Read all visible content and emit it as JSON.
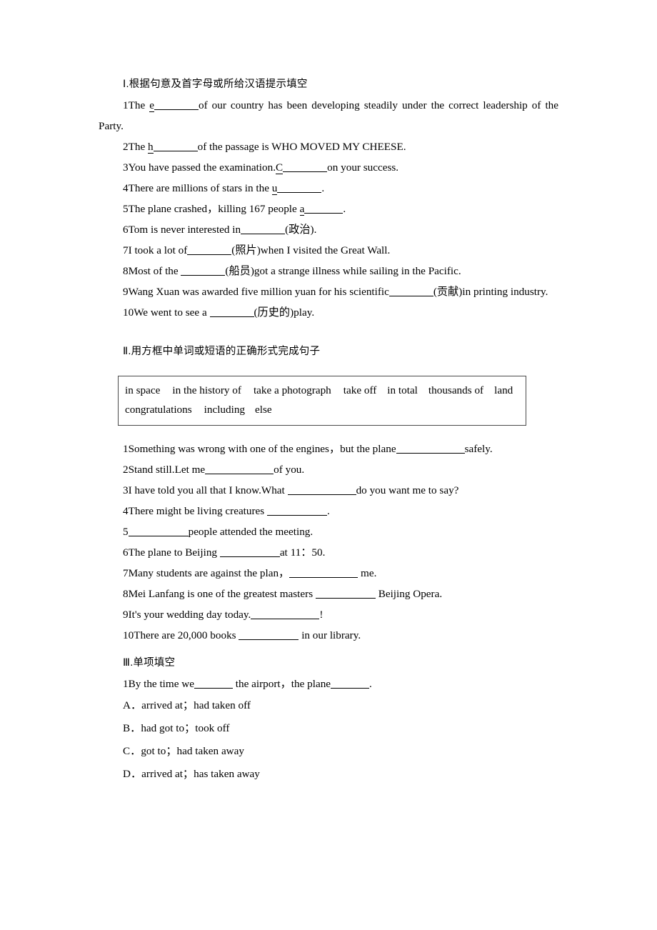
{
  "sections": [
    {
      "id": "section-1",
      "heading": "Ⅰ.根据句意及首字母或所给汉语提示填空",
      "items": [
        {
          "n": "1",
          "pre": "The ",
          "lead": "e",
          "post": "of our country has been developing steadily under the correct leadership of the Party."
        },
        {
          "n": "2",
          "pre": "The ",
          "lead": "h",
          "post": "of the passage is WHO MOVED MY CHEESE."
        },
        {
          "n": "3",
          "pre": "You have passed the examination.",
          "lead": "C",
          "post": "on your success."
        },
        {
          "n": "4",
          "pre": "There are millions of stars in the ",
          "lead": "u",
          "post": "."
        },
        {
          "n": "5",
          "pre": "The plane crashed，killing 167 people ",
          "lead": "a",
          "post": "."
        },
        {
          "n": "6",
          "pre": "Tom is never interested in",
          "lead": "",
          "post": "(政治)."
        },
        {
          "n": "7",
          "pre": "I took a lot of",
          "lead": "",
          "post": "(照片)when I visited the Great Wall."
        },
        {
          "n": "8",
          "pre": "Most of the ",
          "lead": "",
          "post": "(船员)got a strange illness while sailing in the Pacific."
        },
        {
          "n": "9",
          "pre": "Wang Xuan was awarded five million yuan for his scientific",
          "lead": "",
          "post": "(贡献)in printing industry."
        },
        {
          "n": "10",
          "pre": "We went to see a ",
          "lead": "",
          "post": "(历史的)play."
        }
      ]
    },
    {
      "id": "section-2",
      "heading": "Ⅱ.用方框中单词或短语的正确形式完成句子",
      "wordbank": {
        "row1": [
          "in space",
          "in the history of",
          "take a photograph",
          "take off",
          "in total",
          "thousands of",
          "land"
        ],
        "row2": [
          "congratulations",
          "including",
          "else"
        ]
      },
      "items": [
        {
          "n": "1",
          "pre": "Something was wrong with one of the engines，but the plane",
          "post": "safely."
        },
        {
          "n": "2",
          "pre": "Stand still.Let me",
          "post": "of you."
        },
        {
          "n": "3",
          "pre": "I have told you all that I know.What ",
          "post": "do you want me to say?"
        },
        {
          "n": "4",
          "pre": "There might be living creatures ",
          "post": "."
        },
        {
          "n": "5",
          "pre": "",
          "post": "people attended the meeting."
        },
        {
          "n": "6",
          "pre": "The plane to Beijing ",
          "post": "at 11：50."
        },
        {
          "n": "7",
          "pre": "Many students are against the plan，",
          "post": " me."
        },
        {
          "n": "8",
          "pre": "Mei Lanfang is one of the greatest masters ",
          "post": " Beijing Opera."
        },
        {
          "n": "9",
          "pre": "It's your wedding day today.",
          "post": "!"
        },
        {
          "n": "10",
          "pre": "There are 20,000 books ",
          "post": " in our library."
        }
      ]
    },
    {
      "id": "section-3",
      "heading": "Ⅲ.单项填空",
      "stem": {
        "n": "1",
        "pre": "By the time we",
        "mid": " the airport，the plane",
        "post": "."
      },
      "options": [
        {
          "letter": "A．",
          "text": "arrived at；had taken off"
        },
        {
          "letter": "B．",
          "text": "had got to；took off"
        },
        {
          "letter": "C．",
          "text": "got to；had taken away"
        },
        {
          "letter": "D．",
          "text": "arrived at；has taken away"
        }
      ]
    }
  ]
}
